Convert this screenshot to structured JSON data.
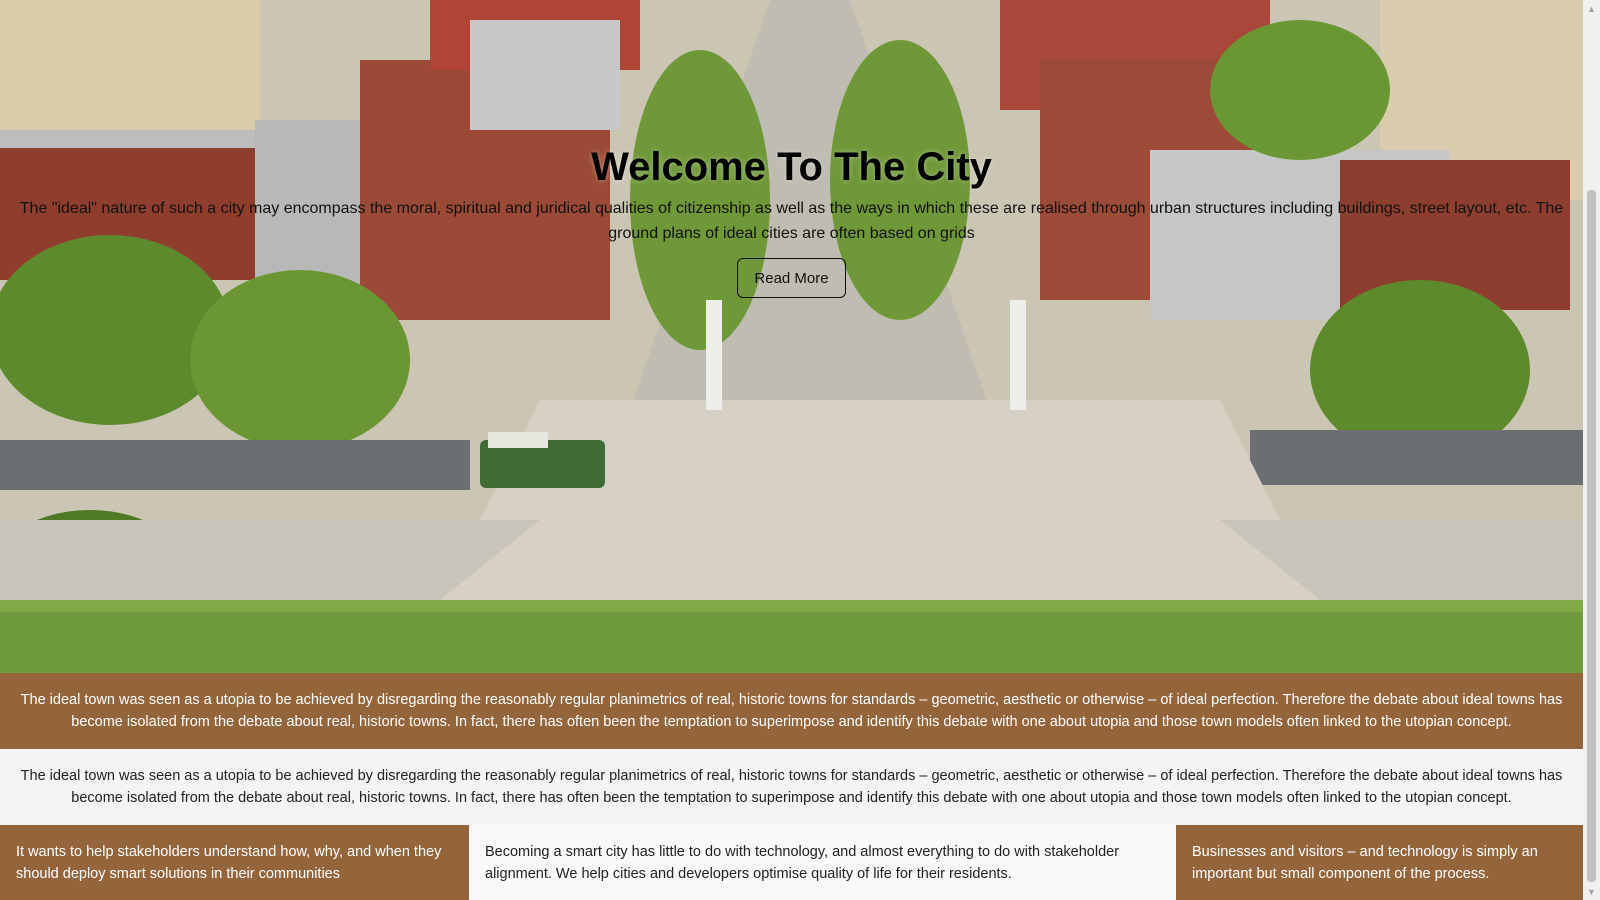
{
  "hero": {
    "image_icon": "city-street-aerial-image",
    "title": "Welcome To The City",
    "text": "The \"ideal\" nature of such a city may encompass the moral, spiritual and juridical qualities of citizenship as well as the ways in which these are realised through urban structures including buildings, street layout, etc. The ground plans of ideal cities are often based on grids",
    "button_label": "Read More"
  },
  "band_brown": {
    "text": "The ideal town was seen as a utopia to be achieved by disregarding the reasonably regular planimetrics of real, historic towns for standards – geometric, aesthetic or otherwise – of ideal perfection. Therefore the debate about ideal towns has become isolated from the debate about real, historic towns. In fact, there has often been the temptation to superimpose and identify this debate with one about utopia and those town models often linked to the utopian concept."
  },
  "band_light": {
    "text": "The ideal town was seen as a utopia to be achieved by disregarding the reasonably regular planimetrics of real, historic towns for standards – geometric, aesthetic or otherwise – of ideal perfection. Therefore the debate about ideal towns has become isolated from the debate about real, historic towns. In fact, there has often been the temptation to superimpose and identify this debate with one about utopia and those town models often linked to the utopian concept."
  },
  "columns": [
    {
      "text": "It wants to help stakeholders understand how, why, and when they should deploy smart solutions in their communities"
    },
    {
      "text": "Becoming a smart city has little to do with technology, and almost everything to do with stakeholder alignment. We help cities and developers optimise quality of life for their residents."
    },
    {
      "text": "Businesses and visitors – and technology is simply an important but small component of the process."
    }
  ],
  "colors": {
    "brown_accent": "#94643b",
    "light_band": "#f4f4f4",
    "grass": "#6f9a3e"
  },
  "scrollbar": {
    "up_icon": "scroll-up-arrow-icon",
    "down_icon": "scroll-down-arrow-icon"
  }
}
